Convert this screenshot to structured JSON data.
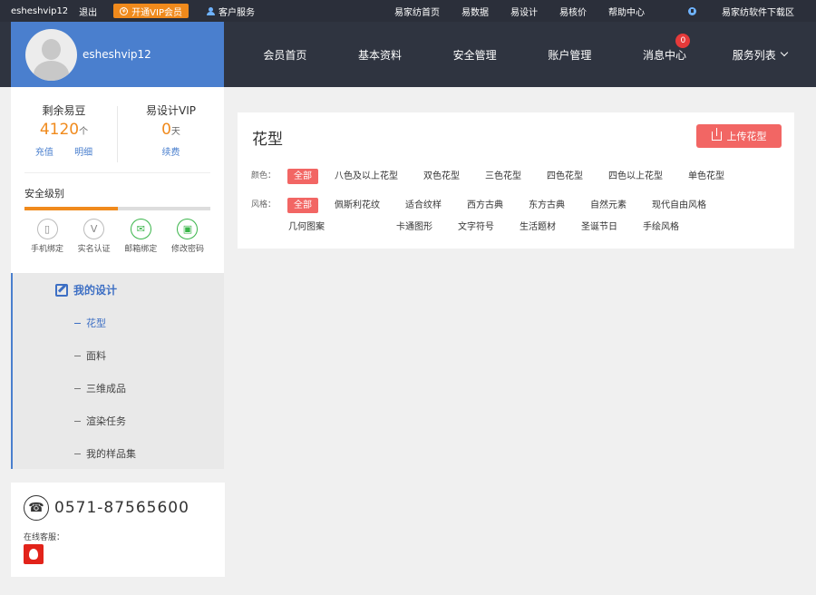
{
  "topbar": {
    "username": "esheshvip12",
    "logout": "退出",
    "vip_btn": "开通VIP会员",
    "customer_service": "客户服务",
    "links": [
      "易家纺首页",
      "易数据",
      "易设计",
      "易核价",
      "帮助中心"
    ],
    "download": "易家纺软件下载区"
  },
  "header": {
    "username": "esheshvip12",
    "nav": [
      {
        "label": "会员首页"
      },
      {
        "label": "基本资料"
      },
      {
        "label": "安全管理"
      },
      {
        "label": "账户管理"
      },
      {
        "label": "消息中心",
        "badge": "0"
      },
      {
        "label": "服务列表"
      }
    ]
  },
  "account": {
    "beans_label": "剩余易豆",
    "beans_value": "4120",
    "beans_unit": "个",
    "recharge": "充值",
    "detail": "明细",
    "vip_label": "易设计VIP",
    "vip_value": "0",
    "vip_unit": "天",
    "renew": "续费"
  },
  "security": {
    "title": "安全级别",
    "level": 0.5,
    "items": [
      {
        "label": "手机绑定",
        "icon": "phone-icon"
      },
      {
        "label": "实名认证",
        "icon": "verify-icon"
      },
      {
        "label": "邮箱绑定",
        "icon": "mail-icon"
      },
      {
        "label": "修改密码",
        "icon": "lock-icon"
      }
    ]
  },
  "side_menu": {
    "head": "我的设计",
    "items": [
      "花型",
      "面料",
      "三维成品",
      "渲染任务",
      "我的样品集"
    ],
    "active": "花型"
  },
  "contact": {
    "phone": "0571-87565600",
    "online_label": "在线客服："
  },
  "main": {
    "title": "花型",
    "upload_label": "上传花型",
    "color_label": "颜色：",
    "color_options": [
      "全部",
      "八色及以上花型",
      "双色花型",
      "三色花型",
      "四色花型",
      "四色以上花型",
      "单色花型"
    ],
    "style_label": "风格：",
    "style_options": [
      "全部",
      "佩斯利花纹",
      "适合纹样",
      "西方古典",
      "东方古典",
      "自然元素",
      "现代自由风格",
      "几何图案",
      "卡通图形",
      "文字符号",
      "生活题材",
      "圣诞节日",
      "手绘风格"
    ]
  },
  "colors": {
    "accent_orange": "#f08a1c",
    "accent_blue": "#4a7fce",
    "accent_red": "#f26664",
    "dark_bar": "#2b2f3a"
  }
}
